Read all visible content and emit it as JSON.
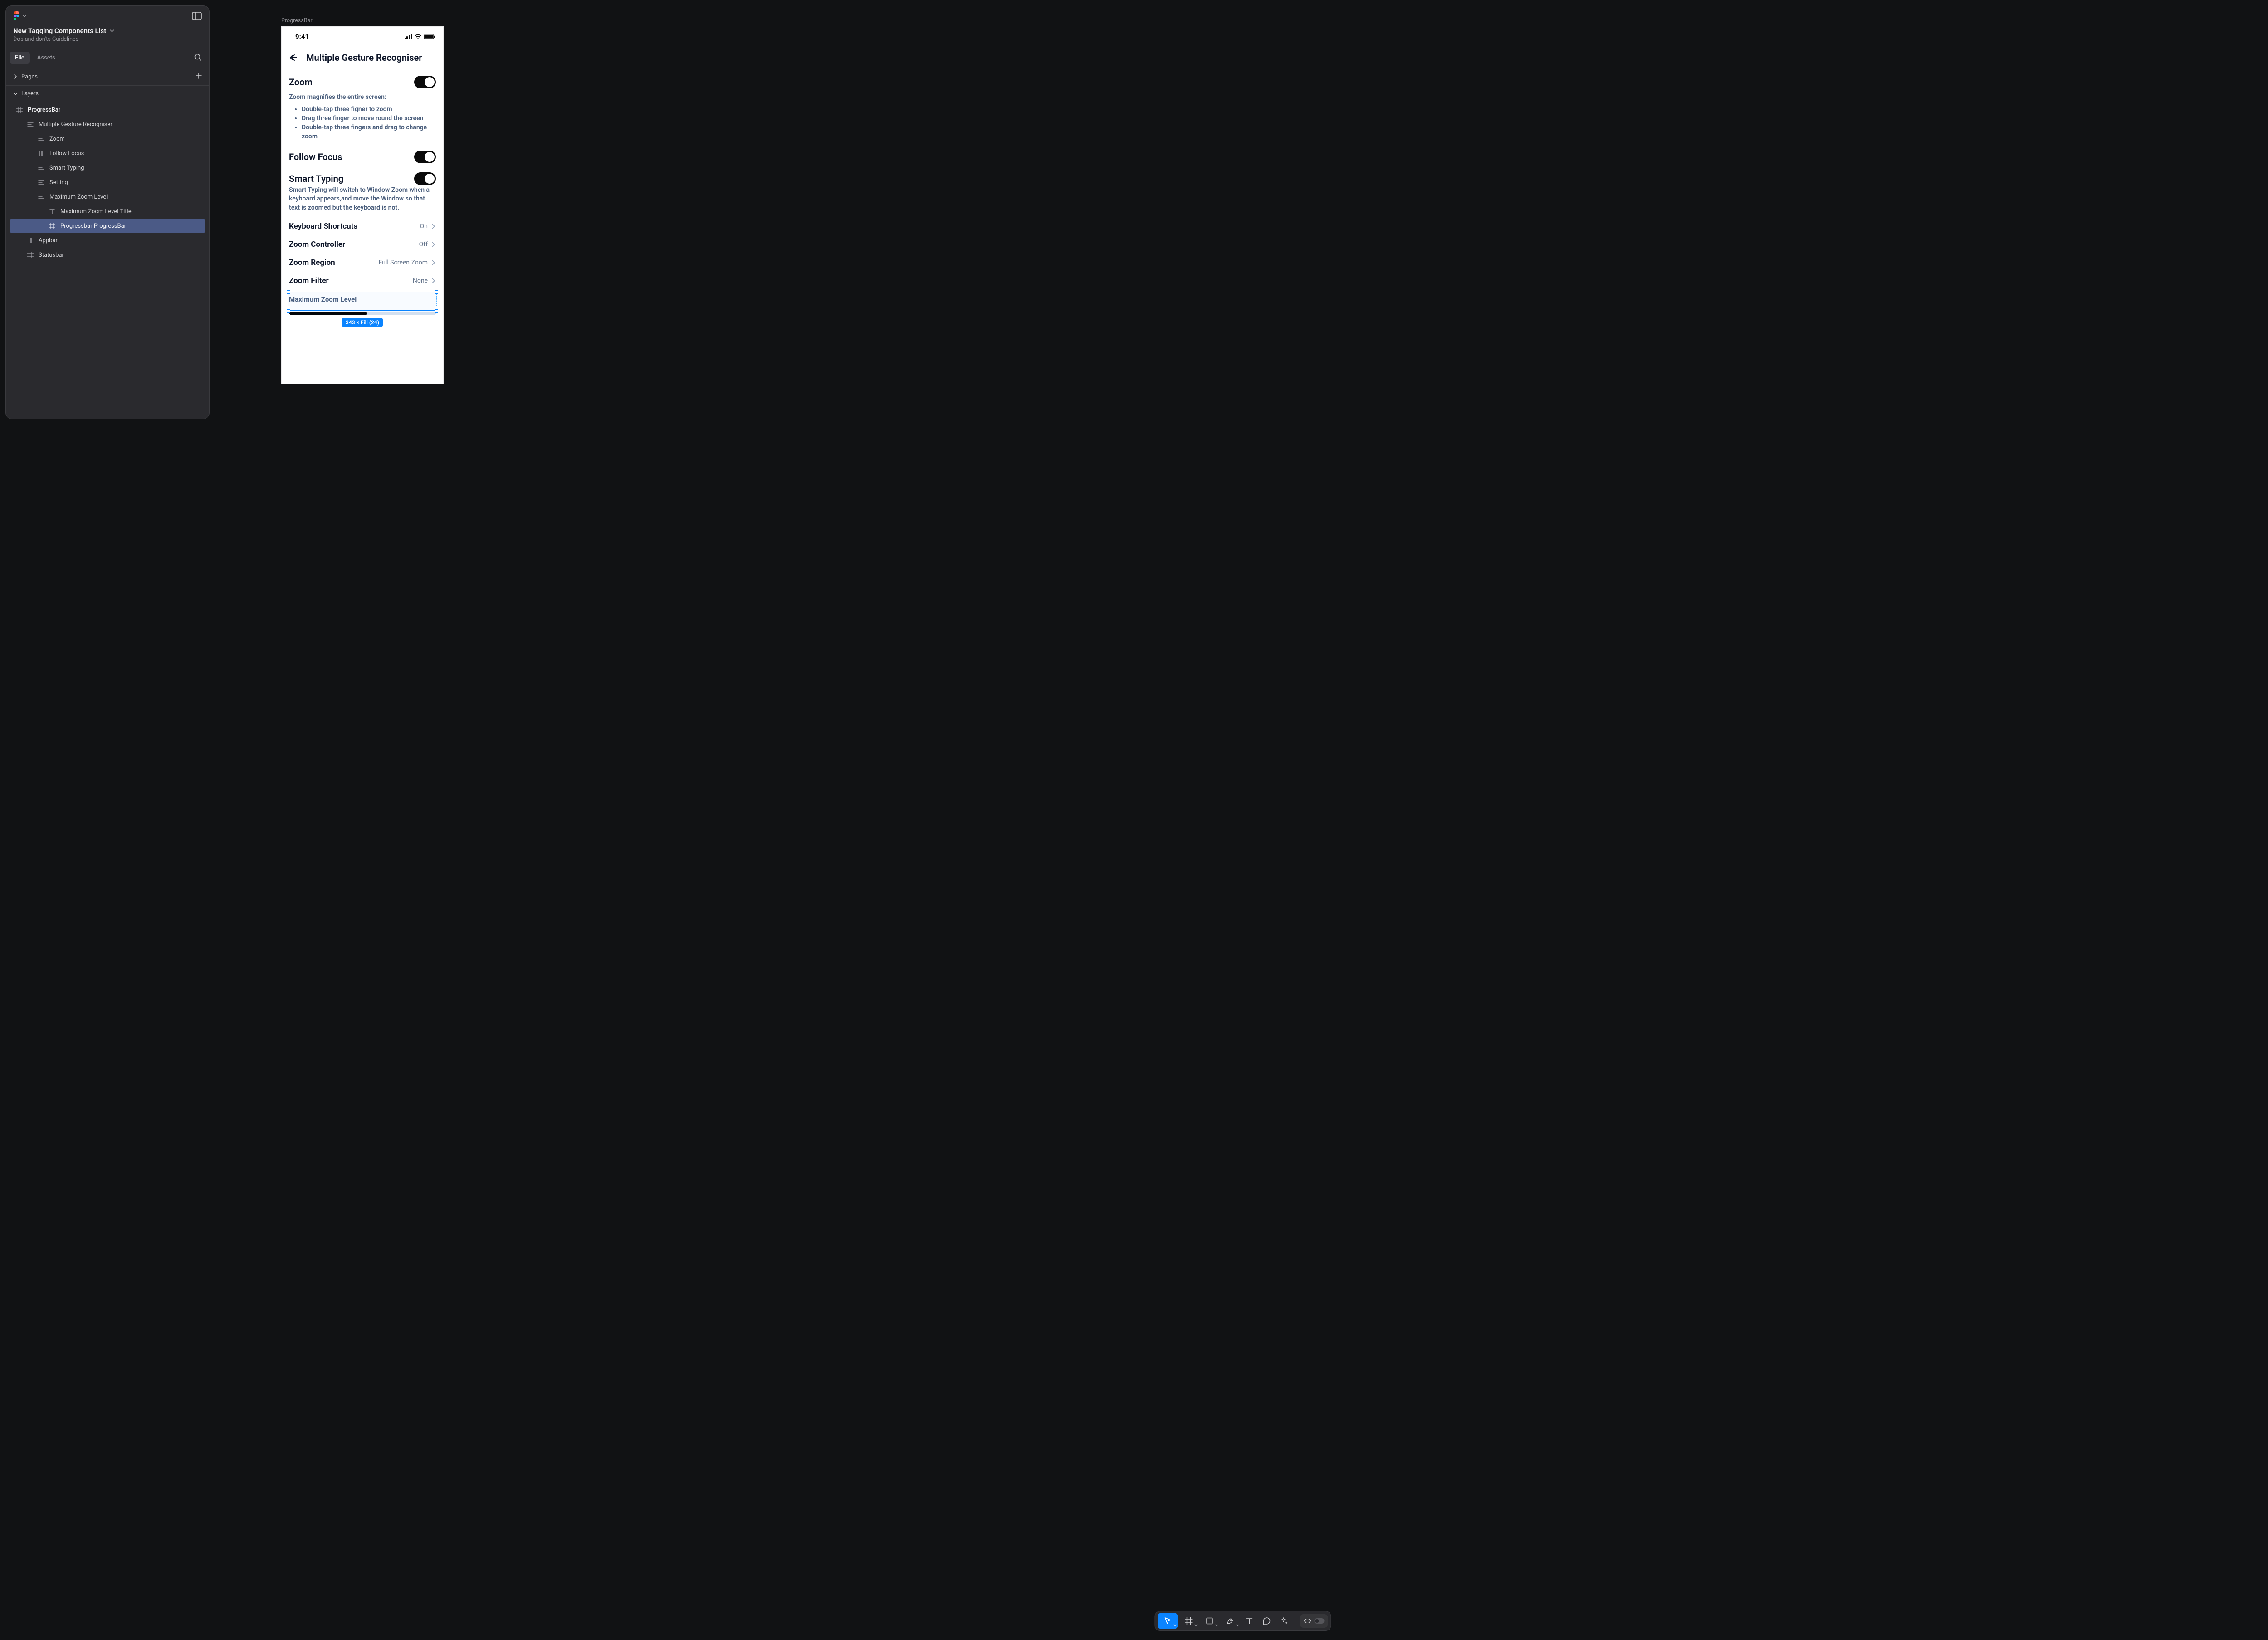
{
  "header": {
    "document_title": "New Tagging Components List",
    "document_subtitle": "Do's and don'ts Guidelines"
  },
  "tabs": {
    "file": "File",
    "assets": "Assets"
  },
  "sections": {
    "pages": "Pages",
    "layers": "Layers"
  },
  "layers": [
    {
      "name": "ProgressBar",
      "icon": "frame",
      "indent": 0,
      "bold": true
    },
    {
      "name": "Multiple Gesture Recogniser",
      "icon": "text-align",
      "indent": 1
    },
    {
      "name": "Zoom",
      "icon": "text-align",
      "indent": 2
    },
    {
      "name": "Follow Focus",
      "icon": "bars-v",
      "indent": 2
    },
    {
      "name": "Smart Typing",
      "icon": "text-align",
      "indent": 2
    },
    {
      "name": "Setting",
      "icon": "text-align",
      "indent": 2
    },
    {
      "name": "Maximum Zoom Level",
      "icon": "text-align",
      "indent": 2
    },
    {
      "name": "Maximum Zoom Level Title",
      "icon": "text-T",
      "indent": 3
    },
    {
      "name": "Progressbar:ProgressBar",
      "icon": "frame",
      "indent": 3,
      "selected": true
    },
    {
      "name": "Appbar",
      "icon": "bars-v",
      "indent": 1
    },
    {
      "name": "Statusbar",
      "icon": "frame",
      "indent": 1
    }
  ],
  "canvas": {
    "frame_label": "ProgressBar",
    "selection_badge": "343 × Fill (24)"
  },
  "statusbar": {
    "time": "9:41"
  },
  "appbar": {
    "title": "Multiple Gesture Recogniser"
  },
  "mock": {
    "zoom": {
      "title": "Zoom",
      "desc": "Zoom magnifies the entire screen:",
      "bullets": [
        "Double-tap three figner to zoom",
        "Drag three finger to move round the screen",
        "Double-tap three fingers and drag to change zoom"
      ]
    },
    "follow_focus": "Follow Focus",
    "smart_typing": {
      "title": "Smart Typing",
      "desc": "Smart Typing will switch to Window Zoom when a keyboard appears,and move the Window so that text is zoomed but the keyboard is not."
    },
    "rows": [
      {
        "label": "Keyboard Shortcuts",
        "value": "On"
      },
      {
        "label": "Zoom Controller",
        "value": "Off"
      },
      {
        "label": "Zoom Region",
        "value": "Full Screen Zoom"
      },
      {
        "label": "Zoom Filter",
        "value": "None"
      }
    ],
    "max_zoom_label": "Maximum Zoom Level"
  }
}
